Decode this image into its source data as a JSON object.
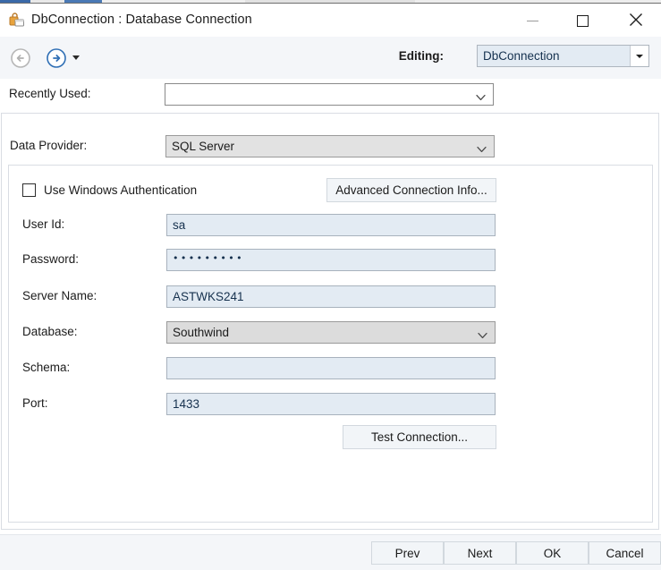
{
  "window": {
    "title": "DbConnection : Database Connection",
    "icon": "database-connection-icon",
    "controls": {
      "minimize": "minimize-icon",
      "maximize": "maximize-icon",
      "close": "close-icon"
    }
  },
  "toolbar": {
    "back_icon": "back-arrow-icon",
    "forward_icon": "forward-arrow-icon",
    "dropdown_icon": "chevron-down-icon",
    "editing_label": "Editing:",
    "editing_value": "DbConnection"
  },
  "recently_used": {
    "label": "Recently Used:",
    "value": "",
    "placeholder": ""
  },
  "data_provider": {
    "label": "Data Provider:",
    "value": "SQL Server"
  },
  "connection": {
    "use_windows_auth": {
      "label": "Use Windows Authentication",
      "checked": false
    },
    "advanced_button": "Advanced Connection Info...",
    "test_button": "Test Connection...",
    "fields": {
      "user_id": {
        "label": "User Id:",
        "value": "sa"
      },
      "password": {
        "label": "Password:",
        "value": "•••••••••",
        "masked": true
      },
      "server_name": {
        "label": "Server Name:",
        "value": "ASTWKS241"
      },
      "database": {
        "label": "Database:",
        "value": "Southwind"
      },
      "schema": {
        "label": "Schema:",
        "value": ""
      },
      "port": {
        "label": "Port:",
        "value": "1433"
      }
    }
  },
  "footer": {
    "prev": "Prev",
    "next": "Next",
    "ok": "OK",
    "cancel": "Cancel"
  },
  "colors": {
    "toolbar_bg": "#f4f6f9",
    "field_bg": "#e3ebf3",
    "combo_bg": "#dcdcdc",
    "accent_blue": "#2f6fb5",
    "icon_orange": "#e8a33d"
  }
}
